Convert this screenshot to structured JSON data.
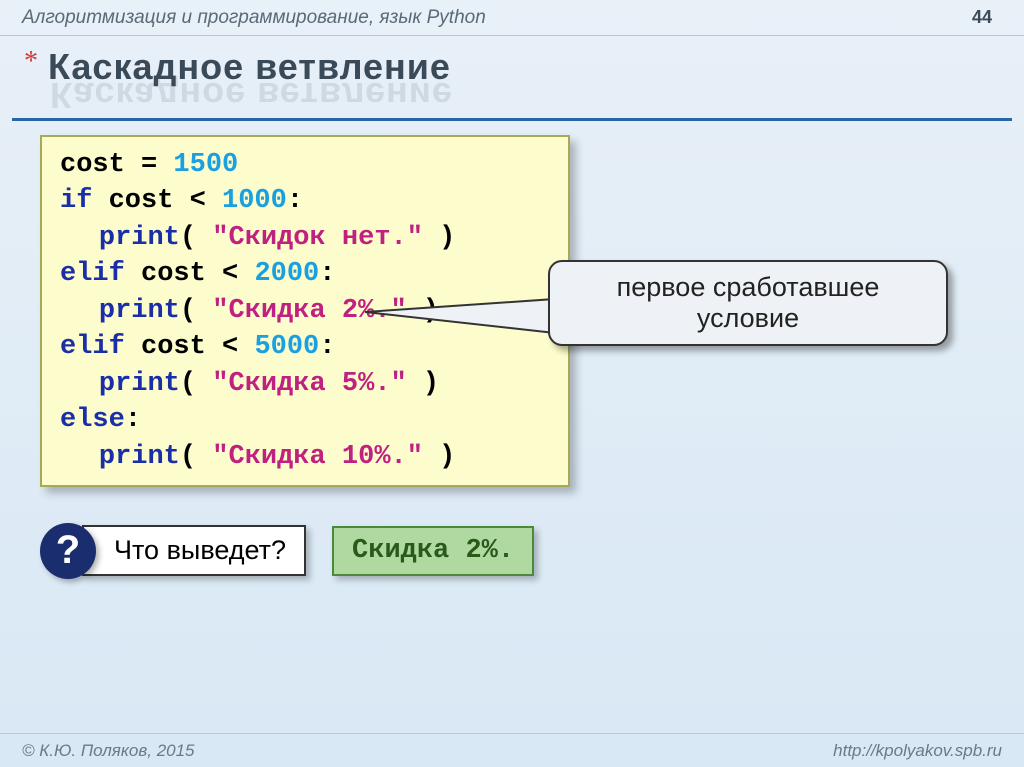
{
  "meta": {
    "course": "Алгоритмизация и программирование, язык Python",
    "page": "44",
    "copyright": "© К.Ю. Поляков, 2015",
    "url": "http://kpolyakov.spb.ru"
  },
  "title": {
    "star": "*",
    "text": "Каскадное ветвление"
  },
  "code": {
    "l1_a": "cost = ",
    "l1_num": "1500",
    "l2_if": "if",
    "l2_b": " cost < ",
    "l2_num": "1000",
    "l2_c": ":",
    "l3_a": "print",
    "l3_b": "( ",
    "l3_str": "\"Скидок нет.\"",
    "l3_c": " )",
    "l4_elif": "elif",
    "l4_b": " cost < ",
    "l4_num": "2000",
    "l4_c": ":",
    "l5_a": "print",
    "l5_b": "( ",
    "l5_str": "\"Скидка 2%.\"",
    "l5_c": " )",
    "l6_elif": "elif",
    "l6_b": " cost < ",
    "l6_num": "5000",
    "l6_c": ":",
    "l7_a": "print",
    "l7_b": "( ",
    "l7_str": "\"Скидка 5%.\"",
    "l7_c": " )",
    "l8_else": "else",
    "l8_c": ":",
    "l9_a": "print",
    "l9_b": "( ",
    "l9_str": "\"Скидка 10%.\"",
    "l9_c": " )"
  },
  "callout": {
    "line1": "первое сработавшее",
    "line2": "условие"
  },
  "question": {
    "mark": "?",
    "text": "Что выведет?",
    "answer": "Скидка 2%."
  }
}
